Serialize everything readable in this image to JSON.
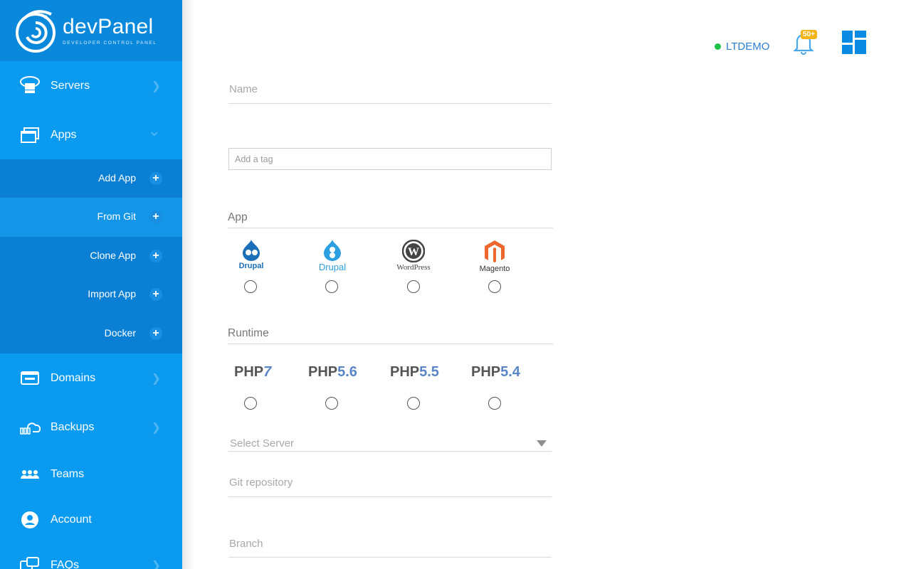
{
  "app": {
    "brand": "devPanel",
    "tagline": "DEVELOPER CONTROL PANEL"
  },
  "sidebar": {
    "items": [
      {
        "label": "Servers",
        "icon": "server-icon",
        "chevron": "❯"
      },
      {
        "label": "Apps",
        "icon": "windows-icon",
        "chevron": "⌄"
      },
      {
        "label": "Domains",
        "icon": "browser-window-icon",
        "chevron": "❯"
      },
      {
        "label": "Backups",
        "icon": "cloud-backup-icon",
        "chevron": "❯"
      },
      {
        "label": "Teams",
        "icon": "team-icon",
        "chevron": ""
      },
      {
        "label": "Account",
        "icon": "user-circle-icon",
        "chevron": ""
      },
      {
        "label": "FAQs",
        "icon": "chat-help-icon",
        "chevron": "❯"
      }
    ],
    "apps_subitems": [
      {
        "label": "Add App",
        "plus": "+"
      },
      {
        "label": "From Git",
        "plus": "+"
      },
      {
        "label": "Clone App",
        "plus": "+"
      },
      {
        "label": "Import App",
        "plus": "+"
      },
      {
        "label": "Docker",
        "plus": "+"
      }
    ]
  },
  "header": {
    "status_label": "LTDEMO",
    "notification_badge": "50+",
    "status_color": "#21c24a"
  },
  "form": {
    "name_placeholder": "Name",
    "tag_placeholder": "Add a tag",
    "app_section_title": "App",
    "apps": [
      {
        "caption": "Drupal"
      },
      {
        "caption": "Drupal"
      },
      {
        "caption": "WordPress"
      },
      {
        "caption": "Magento"
      }
    ],
    "runtime_section_title": "Runtime",
    "runtimes": [
      {
        "prefix": "PHP",
        "version": "7"
      },
      {
        "prefix": "PHP",
        "version": "5.6"
      },
      {
        "prefix": "PHP",
        "version": "5.5"
      },
      {
        "prefix": "PHP",
        "version": "5.4"
      }
    ],
    "server_placeholder": "Select Server",
    "git_placeholder": "Git repository",
    "branch_placeholder": "Branch"
  },
  "colors": {
    "sidebar_bg": "#0a9aef",
    "sidebar_header": "#0a88dc",
    "apps_submenu_bg": "#0a7fd3",
    "active_sub_bg": "#1496e8",
    "accent": "#2a7fd2"
  }
}
